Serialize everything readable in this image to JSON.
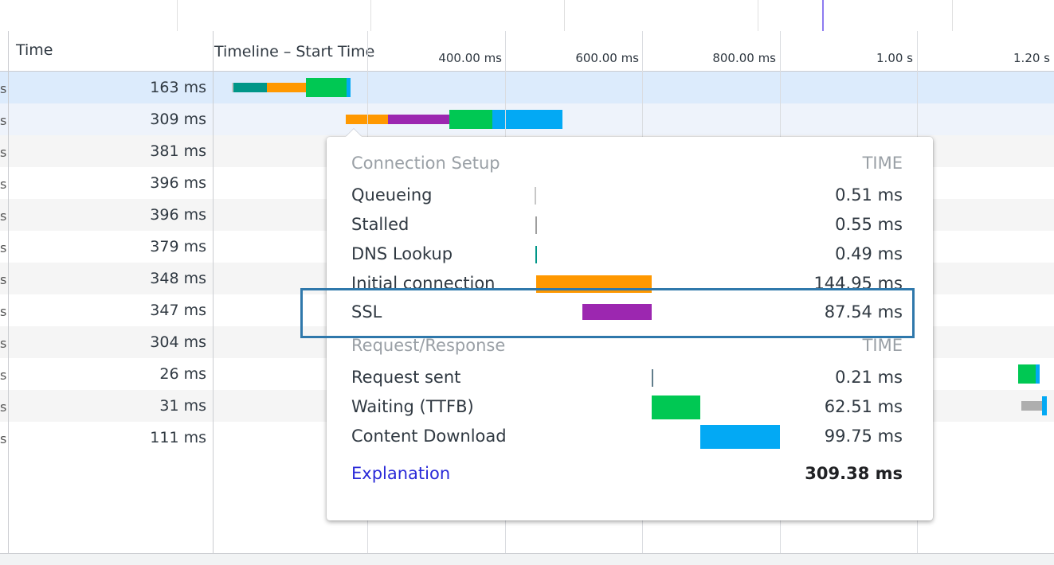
{
  "colors": {
    "queueing": "#c7c7c7",
    "stalled": "#9e9e9e",
    "dns": "#009688",
    "initial_connection": "#ff9800",
    "ssl": "#9c27b0",
    "request_sent": "#607d8b",
    "waiting": "#00c853",
    "content_download": "#03a9f4",
    "highlight_border": "#2f78ab"
  },
  "header": {
    "time_label": "Time",
    "timeline_label": "Timeline – Start Time",
    "ticks": [
      "400.00 ms",
      "600.00 ms",
      "800.00 ms",
      "1.00 s",
      "1.20 s"
    ]
  },
  "rows": [
    {
      "time": "163 ms"
    },
    {
      "time": "309 ms"
    },
    {
      "time": "381 ms"
    },
    {
      "time": "396 ms"
    },
    {
      "time": "396 ms"
    },
    {
      "time": "379 ms"
    },
    {
      "time": "348 ms"
    },
    {
      "time": "347 ms"
    },
    {
      "time": "304 ms"
    },
    {
      "time": "26 ms"
    },
    {
      "time": "31 ms"
    },
    {
      "time": "111 ms"
    }
  ],
  "popup": {
    "connection_setup": {
      "title": "Connection Setup",
      "column": "TIME",
      "items": [
        {
          "label": "Queueing",
          "value": "0.51 ms"
        },
        {
          "label": "Stalled",
          "value": "0.55 ms"
        },
        {
          "label": "DNS Lookup",
          "value": "0.49 ms"
        },
        {
          "label": "Initial connection",
          "value": "144.95 ms"
        },
        {
          "label": "SSL",
          "value": "87.54 ms"
        }
      ]
    },
    "request_response": {
      "title": "Request/Response",
      "column": "TIME",
      "items": [
        {
          "label": "Request sent",
          "value": "0.21 ms"
        },
        {
          "label": "Waiting (TTFB)",
          "value": "62.51 ms"
        },
        {
          "label": "Content Download",
          "value": "99.75 ms"
        }
      ]
    },
    "explanation_link": "Explanation",
    "total": "309.38 ms"
  }
}
